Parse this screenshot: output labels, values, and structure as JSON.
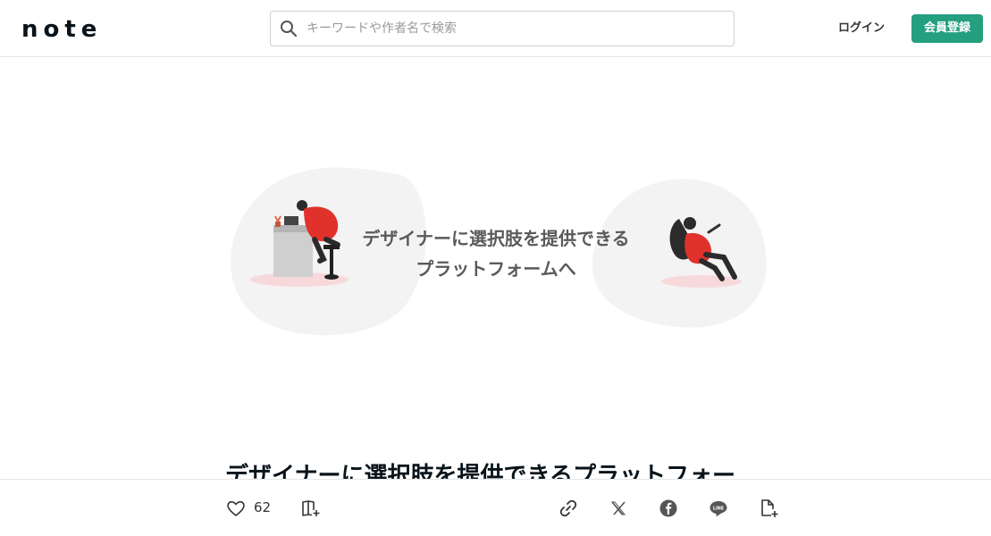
{
  "header": {
    "logo_text": "note",
    "search_placeholder": "キーワードや作者名で検索",
    "login_label": "ログイン",
    "signup_label": "会員登録"
  },
  "hero": {
    "line1": "デザイナーに選択肢を提供できる",
    "line2": "プラットフォームへ"
  },
  "article": {
    "title": "デザイナーに選択肢を提供できるプラットフォー"
  },
  "actions": {
    "like_count": "62",
    "icons": [
      "heart-icon",
      "magazine-add-icon",
      "link-icon",
      "x-icon",
      "facebook-icon",
      "line-icon",
      "embed-add-icon"
    ]
  },
  "colors": {
    "brand": "#249f80",
    "accent_red": "#e0322b"
  }
}
